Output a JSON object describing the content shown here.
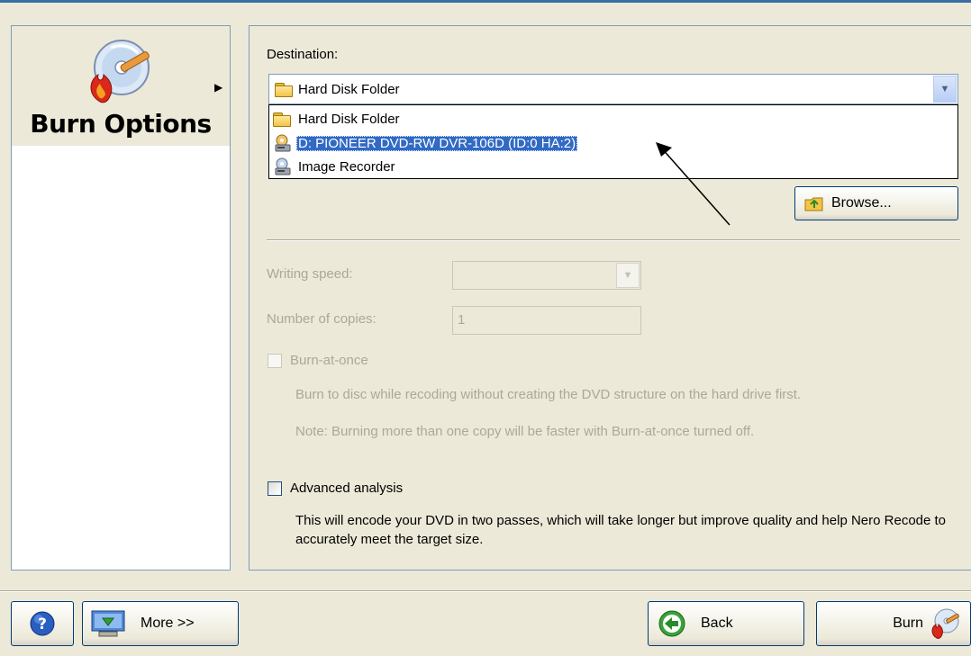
{
  "left": {
    "title": "Burn Options"
  },
  "destination": {
    "label": "Destination:",
    "selected": "Hard Disk Folder",
    "options": [
      {
        "label": "Hard Disk Folder",
        "icon": "folder-icon",
        "selected": false
      },
      {
        "label": "D: PIONEER  DVD-RW  DVR-106D (ID:0 HA:2)",
        "icon": "dvd-drive-icon",
        "selected": true
      },
      {
        "label": "Image Recorder",
        "icon": "image-recorder-icon",
        "selected": false
      }
    ],
    "browse_label": "Browse..."
  },
  "writing_speed": {
    "label": "Writing speed:",
    "value": ""
  },
  "copies": {
    "label": "Number of copies:",
    "value": "1"
  },
  "burn_at_once": {
    "label": "Burn-at-once",
    "checked": false,
    "desc1": "Burn to disc while recoding without creating the DVD structure on the hard drive first.",
    "desc2": "Note: Burning more than one copy will be faster with Burn-at-once turned off."
  },
  "advanced": {
    "label": "Advanced analysis",
    "checked": false,
    "desc": "This will encode your DVD in two passes, which will take longer but improve quality and help Nero Recode to accurately meet the target size."
  },
  "footer": {
    "more_label": "More >>",
    "back_label": "Back",
    "burn_label": "Burn"
  },
  "colors": {
    "selection": "#316ac5",
    "window_bg": "#ece9d8",
    "disabled_text": "#aca899"
  }
}
